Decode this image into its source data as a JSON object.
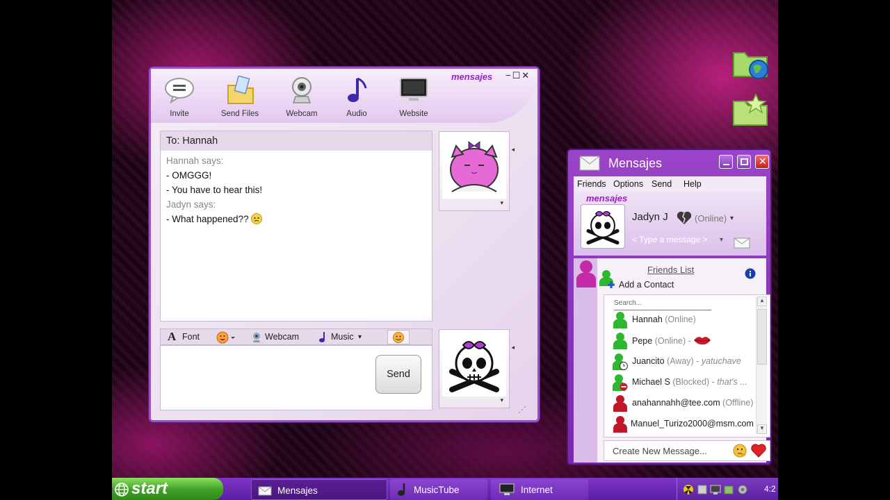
{
  "chat_window": {
    "brand": "mensajes",
    "toolbar": [
      {
        "label": "Invite",
        "icon": "speech-bubble-icon"
      },
      {
        "label": "Send Files",
        "icon": "folder-file-icon"
      },
      {
        "label": "Webcam",
        "icon": "webcam-icon"
      },
      {
        "label": "Audio",
        "icon": "music-note-icon"
      },
      {
        "label": "Website",
        "icon": "computer-monitor-icon"
      }
    ],
    "to_label": "To: Hannah",
    "messages": [
      {
        "text": "Hannah says:",
        "kind": "says"
      },
      {
        "text": "- OMGGG!",
        "kind": "msg"
      },
      {
        "text": "- You have to hear this!",
        "kind": "msg"
      },
      {
        "text": "Jadyn says:",
        "kind": "says"
      },
      {
        "text": "- What happened??",
        "kind": "msg",
        "emoji": "worried-face-icon"
      }
    ],
    "input_toolbar": {
      "font": "Font",
      "webcam": "Webcam",
      "music": "Music"
    },
    "send_label": "Send"
  },
  "mensajes_window": {
    "title": "Mensajes",
    "menu": [
      "Friends",
      "Options",
      "Send",
      "Help"
    ],
    "brand": "mensajes",
    "profile": {
      "name": "Jadyn J",
      "status": "(Online)",
      "message_placeholder": "< Type a message >"
    },
    "friends_list_label": "Friends List",
    "add_contact_label": "Add a Contact",
    "search_placeholder": "Search...",
    "friends": [
      {
        "name": "Hannah",
        "status": "(Online)",
        "note": "",
        "icon_color": "#2fb82f",
        "badge": ""
      },
      {
        "name": "Pepe",
        "status": "(Online) -",
        "note": "",
        "icon_color": "#2fb82f",
        "badge": "lips-icon"
      },
      {
        "name": "Juancito",
        "status": "(Away) -",
        "note": "yatuchave",
        "icon_color": "#2fb82f",
        "badge": "clock-badge-icon"
      },
      {
        "name": "Michael S",
        "status": "(Blocked) -",
        "note": "that's ...",
        "icon_color": "#2fb82f",
        "badge": "blocked-badge-icon"
      },
      {
        "name": "anahannahh@tee.com",
        "status": "(Offline)",
        "note": "",
        "icon_color": "#c0162a",
        "badge": ""
      },
      {
        "name": "Manuel_Turizo2000@msm.com",
        "status": "",
        "note": "",
        "icon_color": "#c0162a",
        "badge": ""
      }
    ],
    "new_message_label": "Create New Message..."
  },
  "taskbar": {
    "start_label": "start",
    "tasks": [
      {
        "label": "Mensajes",
        "icon": "envelope-icon"
      },
      {
        "label": "MusicTube",
        "icon": "music-note-icon"
      },
      {
        "label": "Internet",
        "icon": "computer-monitor-icon"
      }
    ],
    "clock": "4:2"
  },
  "colors": {
    "accent": "#9b4fc6",
    "start_green": "#3fa025",
    "taskbar": "#6a2ab4"
  }
}
